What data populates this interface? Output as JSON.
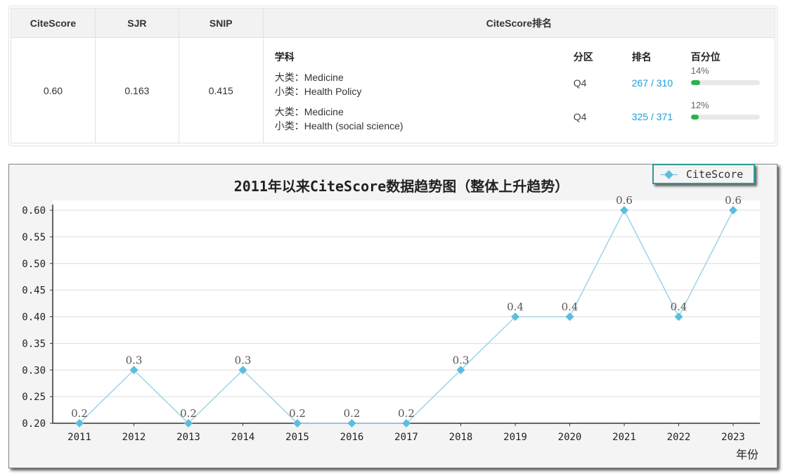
{
  "metrics_table": {
    "headers": [
      "CiteScore",
      "SJR",
      "SNIP",
      "CiteScore排名"
    ],
    "values": {
      "citescore": "0.60",
      "sjr": "0.163",
      "snip": "0.415"
    },
    "rank_columns": {
      "subject": "学科",
      "quartile": "分区",
      "rank": "排名",
      "percentile": "百分位"
    },
    "rows": [
      {
        "major": "大类：Medicine",
        "minor": "小类：Health Policy",
        "quartile": "Q4",
        "rank": "267 / 310",
        "percentile_label": "14%",
        "percentile": 14
      },
      {
        "major": "大类：Medicine",
        "minor": "小类：Health (social science)",
        "quartile": "Q4",
        "rank": "325 / 371",
        "percentile_label": "12%",
        "percentile": 12
      }
    ],
    "colors": {
      "link": "#1a9fd8",
      "bar_fill": "#28b44b",
      "bar_track": "#e9e9e9"
    }
  },
  "chart_data": {
    "type": "line",
    "title": "2011年以来CiteScore数据趋势图（整体上升趋势）",
    "xlabel": "年份",
    "ylabel": "",
    "categories": [
      "2011",
      "2012",
      "2013",
      "2014",
      "2015",
      "2016",
      "2017",
      "2018",
      "2019",
      "2020",
      "2021",
      "2022",
      "2023"
    ],
    "series": [
      {
        "name": "CiteScore",
        "values": [
          0.2,
          0.3,
          0.2,
          0.3,
          0.2,
          0.2,
          0.2,
          0.3,
          0.4,
          0.4,
          0.6,
          0.4,
          0.6
        ],
        "labels": [
          "0.2",
          "0.3",
          "0.2",
          "0.3",
          "0.2",
          "0.2",
          "0.2",
          "0.3",
          "0.4",
          "0.4",
          "0.6",
          "0.4",
          "0.6"
        ],
        "color": "#5bbde0"
      }
    ],
    "ylim": [
      0.2,
      0.6
    ],
    "yticks": [
      "0.20",
      "0.25",
      "0.30",
      "0.35",
      "0.40",
      "0.45",
      "0.50",
      "0.55",
      "0.60"
    ],
    "grid": true,
    "legend": "top-right"
  }
}
